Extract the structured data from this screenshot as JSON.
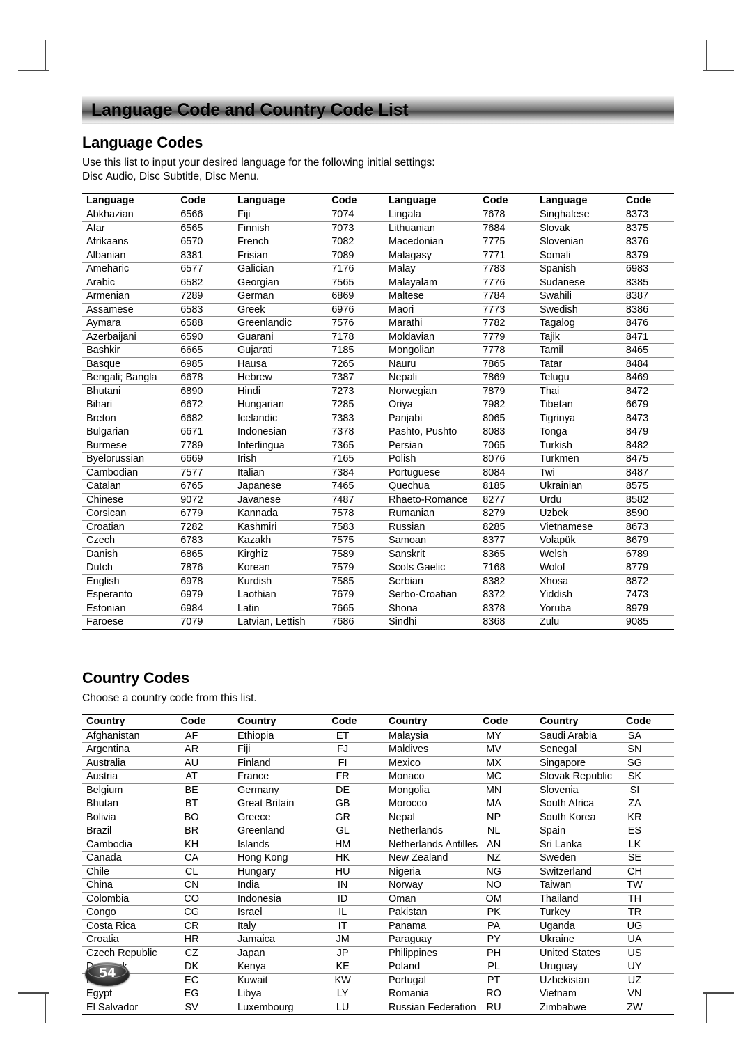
{
  "banner": {
    "title": "Language Code and Country Code List"
  },
  "language_section": {
    "heading": "Language Codes",
    "desc_line1": "Use this list to input your desired language for the following initial settings:",
    "desc_line2": "Disc Audio, Disc Subtitle, Disc Menu.",
    "headers": {
      "name": "Language",
      "code": "Code"
    },
    "columns": [
      [
        [
          "Abkhazian",
          "6566"
        ],
        [
          "Afar",
          "6565"
        ],
        [
          "Afrikaans",
          "6570"
        ],
        [
          "Albanian",
          "8381"
        ],
        [
          "Ameharic",
          "6577"
        ],
        [
          "Arabic",
          "6582"
        ],
        [
          "Armenian",
          "7289"
        ],
        [
          "Assamese",
          "6583"
        ],
        [
          "Aymara",
          "6588"
        ],
        [
          "Azerbaijani",
          "6590"
        ],
        [
          "Bashkir",
          "6665"
        ],
        [
          "Basque",
          "6985"
        ],
        [
          "Bengali; Bangla",
          "6678"
        ],
        [
          "Bhutani",
          "6890"
        ],
        [
          "Bihari",
          "6672"
        ],
        [
          "Breton",
          "6682"
        ],
        [
          "Bulgarian",
          "6671"
        ],
        [
          "Burmese",
          "7789"
        ],
        [
          "Byelorussian",
          "6669"
        ],
        [
          "Cambodian",
          "7577"
        ],
        [
          "Catalan",
          "6765"
        ],
        [
          "Chinese",
          "9072"
        ],
        [
          "Corsican",
          "6779"
        ],
        [
          "Croatian",
          "7282"
        ],
        [
          "Czech",
          "6783"
        ],
        [
          "Danish",
          "6865"
        ],
        [
          "Dutch",
          "7876"
        ],
        [
          "English",
          "6978"
        ],
        [
          "Esperanto",
          "6979"
        ],
        [
          "Estonian",
          "6984"
        ],
        [
          "Faroese",
          "7079"
        ]
      ],
      [
        [
          "Fiji",
          "7074"
        ],
        [
          "Finnish",
          "7073"
        ],
        [
          "French",
          "7082"
        ],
        [
          "Frisian",
          "7089"
        ],
        [
          "Galician",
          "7176"
        ],
        [
          "Georgian",
          "7565"
        ],
        [
          "German",
          "6869"
        ],
        [
          "Greek",
          "6976"
        ],
        [
          "Greenlandic",
          "7576"
        ],
        [
          "Guarani",
          "7178"
        ],
        [
          "Gujarati",
          "7185"
        ],
        [
          "Hausa",
          "7265"
        ],
        [
          "Hebrew",
          "7387"
        ],
        [
          "Hindi",
          "7273"
        ],
        [
          "Hungarian",
          "7285"
        ],
        [
          "Icelandic",
          "7383"
        ],
        [
          "Indonesian",
          "7378"
        ],
        [
          "Interlingua",
          "7365"
        ],
        [
          "Irish",
          "7165"
        ],
        [
          "Italian",
          "7384"
        ],
        [
          "Japanese",
          "7465"
        ],
        [
          "Javanese",
          "7487"
        ],
        [
          "Kannada",
          "7578"
        ],
        [
          "Kashmiri",
          "7583"
        ],
        [
          "Kazakh",
          "7575"
        ],
        [
          "Kirghiz",
          "7589"
        ],
        [
          "Korean",
          "7579"
        ],
        [
          "Kurdish",
          "7585"
        ],
        [
          "Laothian",
          "7679"
        ],
        [
          "Latin",
          "7665"
        ],
        [
          "Latvian, Lettish",
          "7686"
        ]
      ],
      [
        [
          "Lingala",
          "7678"
        ],
        [
          "Lithuanian",
          "7684"
        ],
        [
          "Macedonian",
          "7775"
        ],
        [
          "Malagasy",
          "7771"
        ],
        [
          "Malay",
          "7783"
        ],
        [
          "Malayalam",
          "7776"
        ],
        [
          "Maltese",
          "7784"
        ],
        [
          "Maori",
          "7773"
        ],
        [
          "Marathi",
          "7782"
        ],
        [
          "Moldavian",
          "7779"
        ],
        [
          "Mongolian",
          "7778"
        ],
        [
          "Nauru",
          "7865"
        ],
        [
          "Nepali",
          "7869"
        ],
        [
          "Norwegian",
          "7879"
        ],
        [
          "Oriya",
          "7982"
        ],
        [
          "Panjabi",
          "8065"
        ],
        [
          "Pashto, Pushto",
          "8083"
        ],
        [
          "Persian",
          "7065"
        ],
        [
          "Polish",
          "8076"
        ],
        [
          "Portuguese",
          "8084"
        ],
        [
          "Quechua",
          "8185"
        ],
        [
          "Rhaeto-Romance",
          "8277"
        ],
        [
          "Rumanian",
          "8279"
        ],
        [
          "Russian",
          "8285"
        ],
        [
          "Samoan",
          "8377"
        ],
        [
          "Sanskrit",
          "8365"
        ],
        [
          "Scots Gaelic",
          "7168"
        ],
        [
          "Serbian",
          "8382"
        ],
        [
          "Serbo-Croatian",
          "8372"
        ],
        [
          "Shona",
          "8378"
        ],
        [
          "Sindhi",
          "8368"
        ]
      ],
      [
        [
          "Singhalese",
          "8373"
        ],
        [
          "Slovak",
          "8375"
        ],
        [
          "Slovenian",
          "8376"
        ],
        [
          "Somali",
          "8379"
        ],
        [
          "Spanish",
          "6983"
        ],
        [
          "Sudanese",
          "8385"
        ],
        [
          "Swahili",
          "8387"
        ],
        [
          "Swedish",
          "8386"
        ],
        [
          "Tagalog",
          "8476"
        ],
        [
          "Tajik",
          "8471"
        ],
        [
          "Tamil",
          "8465"
        ],
        [
          "Tatar",
          "8484"
        ],
        [
          "Telugu",
          "8469"
        ],
        [
          "Thai",
          "8472"
        ],
        [
          "Tibetan",
          "6679"
        ],
        [
          "Tigrinya",
          "8473"
        ],
        [
          "Tonga",
          "8479"
        ],
        [
          "Turkish",
          "8482"
        ],
        [
          "Turkmen",
          "8475"
        ],
        [
          "Twi",
          "8487"
        ],
        [
          "Ukrainian",
          "8575"
        ],
        [
          "Urdu",
          "8582"
        ],
        [
          "Uzbek",
          "8590"
        ],
        [
          "Vietnamese",
          "8673"
        ],
        [
          "Volapük",
          "8679"
        ],
        [
          "Welsh",
          "6789"
        ],
        [
          "Wolof",
          "8779"
        ],
        [
          "Xhosa",
          "8872"
        ],
        [
          "Yiddish",
          "7473"
        ],
        [
          "Yoruba",
          "8979"
        ],
        [
          "Zulu",
          "9085"
        ]
      ]
    ]
  },
  "country_section": {
    "heading": "Country Codes",
    "desc_line1": "Choose a country code from this list.",
    "headers": {
      "name": "Country",
      "code": "Code"
    },
    "columns": [
      [
        [
          "Afghanistan",
          "AF"
        ],
        [
          "Argentina",
          "AR"
        ],
        [
          "Australia",
          "AU"
        ],
        [
          "Austria",
          "AT"
        ],
        [
          "Belgium",
          "BE"
        ],
        [
          "Bhutan",
          "BT"
        ],
        [
          "Bolivia",
          "BO"
        ],
        [
          "Brazil",
          "BR"
        ],
        [
          "Cambodia",
          "KH"
        ],
        [
          "Canada",
          "CA"
        ],
        [
          "Chile",
          "CL"
        ],
        [
          "China",
          "CN"
        ],
        [
          "Colombia",
          "CO"
        ],
        [
          "Congo",
          "CG"
        ],
        [
          "Costa Rica",
          "CR"
        ],
        [
          "Croatia",
          "HR"
        ],
        [
          "Czech Republic",
          "CZ"
        ],
        [
          "Denmark",
          "DK"
        ],
        [
          "Ecuador",
          "EC"
        ],
        [
          "Egypt",
          "EG"
        ],
        [
          "El Salvador",
          "SV"
        ]
      ],
      [
        [
          "Ethiopia",
          "ET"
        ],
        [
          "Fiji",
          "FJ"
        ],
        [
          "Finland",
          "FI"
        ],
        [
          "France",
          "FR"
        ],
        [
          "Germany",
          "DE"
        ],
        [
          "Great Britain",
          "GB"
        ],
        [
          "Greece",
          "GR"
        ],
        [
          "Greenland",
          "GL"
        ],
        [
          "Islands",
          "HM"
        ],
        [
          "Hong Kong",
          "HK"
        ],
        [
          "Hungary",
          "HU"
        ],
        [
          "India",
          "IN"
        ],
        [
          "Indonesia",
          "ID"
        ],
        [
          "Israel",
          "IL"
        ],
        [
          "Italy",
          "IT"
        ],
        [
          "Jamaica",
          "JM"
        ],
        [
          "Japan",
          "JP"
        ],
        [
          "Kenya",
          "KE"
        ],
        [
          "Kuwait",
          "KW"
        ],
        [
          "Libya",
          "LY"
        ],
        [
          "Luxembourg",
          "LU"
        ]
      ],
      [
        [
          "Malaysia",
          "MY"
        ],
        [
          "Maldives",
          "MV"
        ],
        [
          "Mexico",
          "MX"
        ],
        [
          "Monaco",
          "MC"
        ],
        [
          "Mongolia",
          "MN"
        ],
        [
          "Morocco",
          "MA"
        ],
        [
          "Nepal",
          "NP"
        ],
        [
          "Netherlands",
          "NL"
        ],
        [
          "Netherlands Antilles",
          "AN"
        ],
        [
          "New Zealand",
          "NZ"
        ],
        [
          "Nigeria",
          "NG"
        ],
        [
          "Norway",
          "NO"
        ],
        [
          "Oman",
          "OM"
        ],
        [
          "Pakistan",
          "PK"
        ],
        [
          "Panama",
          "PA"
        ],
        [
          "Paraguay",
          "PY"
        ],
        [
          "Philippines",
          "PH"
        ],
        [
          "Poland",
          "PL"
        ],
        [
          "Portugal",
          "PT"
        ],
        [
          "Romania",
          "RO"
        ],
        [
          "Russian Federation",
          "RU"
        ]
      ],
      [
        [
          "Saudi Arabia",
          "SA"
        ],
        [
          "Senegal",
          "SN"
        ],
        [
          "Singapore",
          "SG"
        ],
        [
          "Slovak Republic",
          "SK"
        ],
        [
          "Slovenia",
          "SI"
        ],
        [
          "South Africa",
          "ZA"
        ],
        [
          "South Korea",
          "KR"
        ],
        [
          "Spain",
          "ES"
        ],
        [
          "Sri Lanka",
          "LK"
        ],
        [
          "Sweden",
          "SE"
        ],
        [
          "Switzerland",
          "CH"
        ],
        [
          "Taiwan",
          "TW"
        ],
        [
          "Thailand",
          "TH"
        ],
        [
          "Turkey",
          "TR"
        ],
        [
          "Uganda",
          "UG"
        ],
        [
          "Ukraine",
          "UA"
        ],
        [
          "United States",
          "US"
        ],
        [
          "Uruguay",
          "UY"
        ],
        [
          "Uzbekistan",
          "UZ"
        ],
        [
          "Vietnam",
          "VN"
        ],
        [
          "Zimbabwe",
          "ZW"
        ]
      ]
    ]
  },
  "page_number": "54"
}
